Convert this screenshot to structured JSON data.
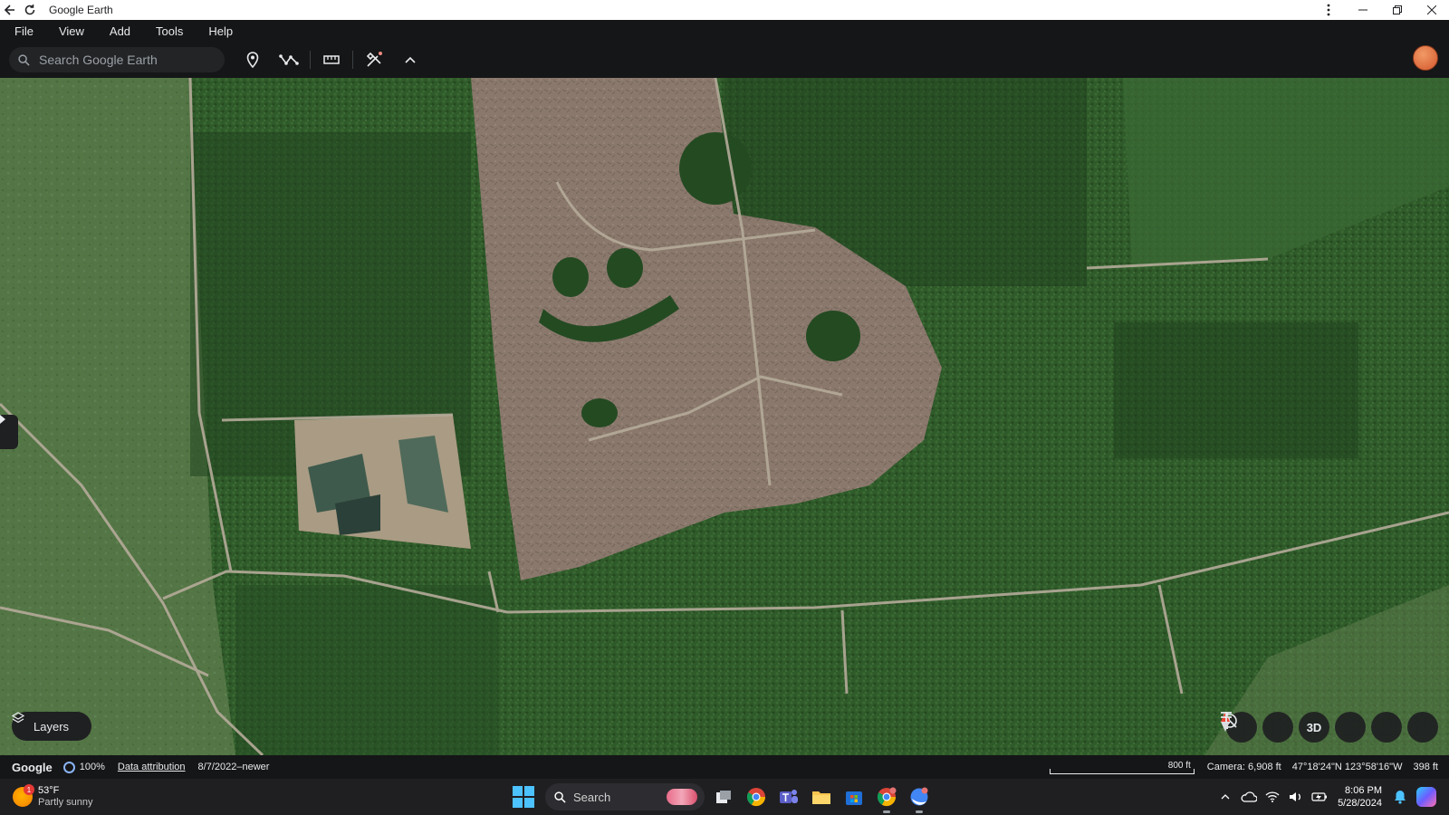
{
  "window": {
    "title": "Google Earth"
  },
  "menu": {
    "items": [
      "File",
      "View",
      "Add",
      "Tools",
      "Help"
    ]
  },
  "toolbar": {
    "search_placeholder": "Search Google Earth"
  },
  "map": {
    "layers_label": "Layers",
    "view_mode_label": "3D"
  },
  "status": {
    "logo": "Google",
    "load_percent": "100%",
    "data_attribution": "Data attribution",
    "imagery_date": "8/7/2022–newer",
    "scale_label": "800 ft",
    "camera": "Camera: 6,908 ft",
    "coordinates": "47°18'24\"N 123°58'16\"W",
    "elevation": "398 ft"
  },
  "taskbar": {
    "weather_badge": "1",
    "temperature": "53°F",
    "condition": "Partly sunny",
    "search_label": "Search",
    "time": "8:06 PM",
    "date": "5/28/2024"
  },
  "colors": {
    "forest": "#2f5a2a",
    "forest_dark": "#244a22",
    "clearcut": "#8c7a6e",
    "grassland": "#5b7a4a",
    "road": "#b5ab9a",
    "accent_blue": "#8ab4f8"
  }
}
